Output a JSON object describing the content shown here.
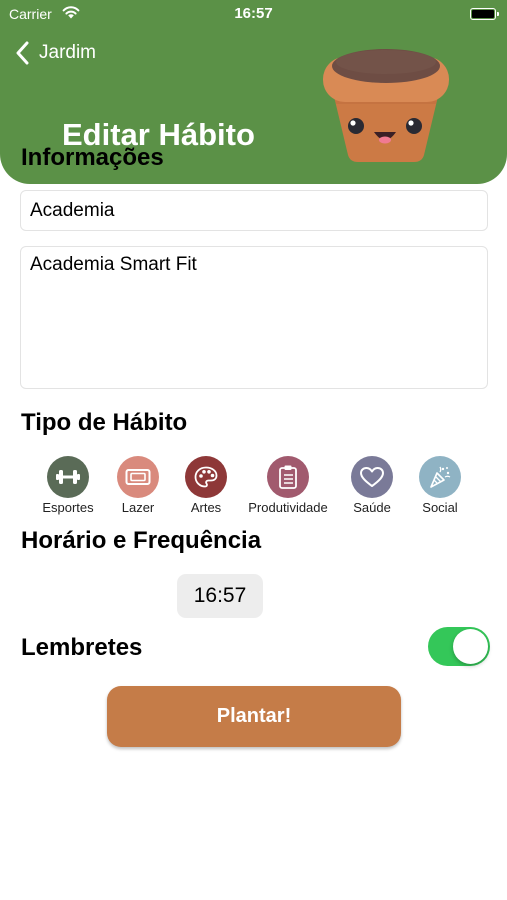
{
  "status_bar": {
    "carrier": "Carrier",
    "time": "16:57"
  },
  "header": {
    "back_label": "Jardim",
    "title": "Editar Hábito",
    "background_color": "#5b9147"
  },
  "info": {
    "heading": "Informações",
    "name_value": "Academia",
    "description_value": "Academia Smart Fit"
  },
  "habit_type": {
    "heading": "Tipo de Hábito",
    "options": [
      {
        "label": "Esportes",
        "icon": "dumbbell-icon",
        "color": "#5a6b57"
      },
      {
        "label": "Lazer",
        "icon": "ticket-icon",
        "color": "#d98a7d"
      },
      {
        "label": "Artes",
        "icon": "palette-icon",
        "color": "#8e3838"
      },
      {
        "label": "Produtividade",
        "icon": "clipboard-icon",
        "color": "#a15a6e"
      },
      {
        "label": "Saúde",
        "icon": "heart-icon",
        "color": "#7a7a98"
      },
      {
        "label": "Social",
        "icon": "party-popper-icon",
        "color": "#8fb3c4"
      }
    ]
  },
  "schedule": {
    "heading": "Horário e Frequência",
    "time": "16:57"
  },
  "reminders": {
    "heading": "Lembretes",
    "enabled": true,
    "toggle_color": "#34c759"
  },
  "submit": {
    "label": "Plantar!",
    "color": "#c57c48"
  }
}
